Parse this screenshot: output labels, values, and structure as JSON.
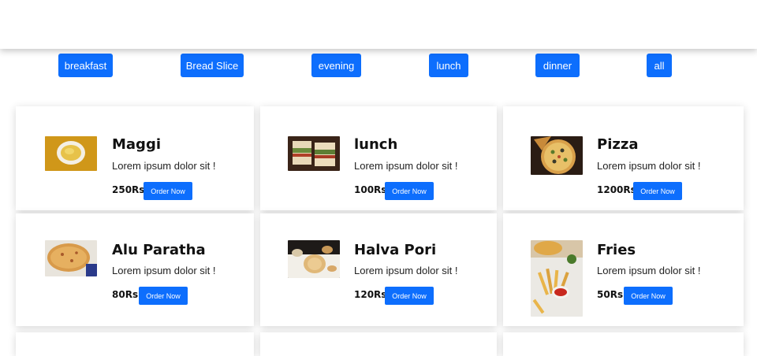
{
  "filters": [
    {
      "label": "breakfast"
    },
    {
      "label": "Bread Slice"
    },
    {
      "label": "evening"
    },
    {
      "label": "lunch"
    },
    {
      "label": "dinner"
    },
    {
      "label": "all"
    }
  ],
  "menu": {
    "items": [
      {
        "title": "Maggi",
        "description": "Lorem ipsum dolor sit !",
        "price": "250Rs",
        "button": "Order Now"
      },
      {
        "title": "lunch",
        "description": "Lorem ipsum dolor sit !",
        "price": "100Rs",
        "button": "Order Now"
      },
      {
        "title": "Pizza",
        "description": "Lorem ipsum dolor sit !",
        "price": "1200Rs",
        "button": "Order Now"
      },
      {
        "title": "Alu Paratha",
        "description": "Lorem ipsum dolor sit !",
        "price": "80Rs",
        "button": "Order Now"
      },
      {
        "title": "Halva Pori",
        "description": "Lorem ipsum dolor sit !",
        "price": "120Rs",
        "button": "Order Now"
      },
      {
        "title": "Fries",
        "description": "Lorem ipsum dolor sit !",
        "price": "50Rs",
        "button": "Order Now"
      }
    ]
  },
  "colors": {
    "accent": "#0d6efd",
    "background": "#ffffff"
  }
}
